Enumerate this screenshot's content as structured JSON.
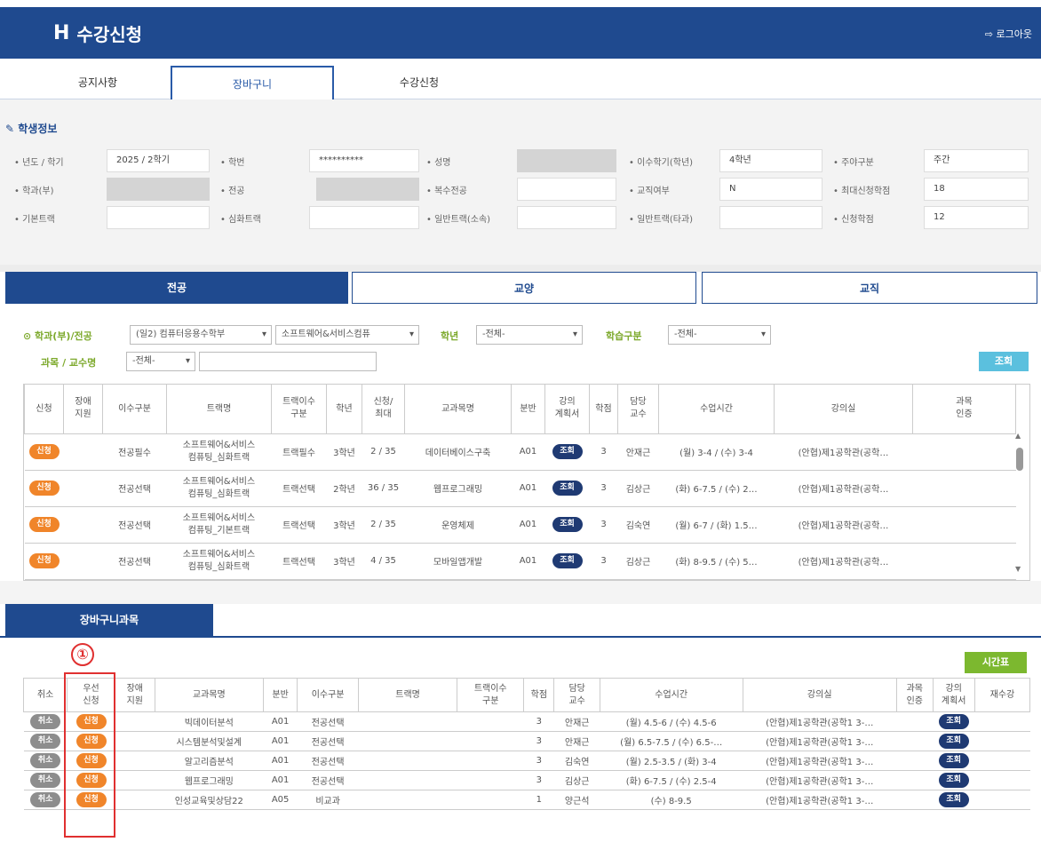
{
  "header": {
    "logo": "H",
    "title": "수강신청",
    "logout_label": "로그아웃"
  },
  "nav_tabs": [
    {
      "label": "공지사항",
      "active": false
    },
    {
      "label": "장바구니",
      "active": true
    },
    {
      "label": "수강신청",
      "active": false
    }
  ],
  "student_info": {
    "title": "학생정보",
    "fields": [
      {
        "label": "• 년도 / 학기",
        "value": "2025 / 2학기"
      },
      {
        "label": "• 학번",
        "value": "**********"
      },
      {
        "label": "• 성명",
        "value": ""
      },
      {
        "label": "• 이수학기(학년)",
        "value": "4학년"
      },
      {
        "label": "• 주야구분",
        "value": "주간"
      },
      {
        "label": "• 학과(부)",
        "value": ""
      },
      {
        "label": "• 전공",
        "value": ""
      },
      {
        "label": "• 복수전공",
        "value": ""
      },
      {
        "label": "• 교직여부",
        "value": "N"
      },
      {
        "label": "• 최대신청학점",
        "value": "18"
      },
      {
        "label": "• 기본트랙",
        "value": ""
      },
      {
        "label": "• 심화트랙",
        "value": ""
      },
      {
        "label": "• 일반트랙(소속)",
        "value": ""
      },
      {
        "label": "• 일반트랙(타과)",
        "value": ""
      },
      {
        "label": "• 신청학점",
        "value": "12"
      }
    ]
  },
  "category_tabs": [
    {
      "label": "전공",
      "active": true
    },
    {
      "label": "교양",
      "active": false
    },
    {
      "label": "교직",
      "active": false
    }
  ],
  "filters": {
    "dept_label": "학과(부)/전공",
    "dept_value": "(일2) 컴퓨터응용수학부",
    "major_value": "소프트웨어&서비스컴퓨",
    "year_label": "학년",
    "year_value": "-전체-",
    "type_label": "학습구분",
    "type_value": "-전체-",
    "subject_label": "과목 / 교수명",
    "subject_value": "-전체-",
    "search_text": "",
    "search_button": "조회"
  },
  "course_table": {
    "headers": [
      "신청",
      "장애\n지원",
      "이수구분",
      "트랙명",
      "트랙이수\n구분",
      "학년",
      "신청/\n최대",
      "교과목명",
      "분반",
      "강의\n계획서",
      "학점",
      "담당\n교수",
      "수업시간",
      "강의실",
      "과목\n인증"
    ],
    "apply_label": "신청",
    "syllabus_label": "조회",
    "rows": [
      {
        "type": "전공필수",
        "track": "소프트웨어&서비스\n컴퓨팅_심화트랙",
        "track_type": "트랙필수",
        "year": "3학년",
        "count": "2 / 35",
        "name": "데이터베이스구축",
        "section": "A01",
        "credit": "3",
        "prof": "안재근",
        "time": "(월) 3-4 / (수) 3-4",
        "room": "(안협)제1공학관(공학…"
      },
      {
        "type": "전공선택",
        "track": "소프트웨어&서비스\n컴퓨팅_심화트랙",
        "track_type": "트랙선택",
        "year": "2학년",
        "count": "36 / 35",
        "name": "웹프로그래밍",
        "section": "A01",
        "credit": "3",
        "prof": "김상근",
        "time": "(화) 6-7.5 / (수) 2…",
        "room": "(안협)제1공학관(공학…"
      },
      {
        "type": "전공선택",
        "track": "소프트웨어&서비스\n컴퓨팅_기본트랙",
        "track_type": "트랙선택",
        "year": "3학년",
        "count": "2 / 35",
        "name": "운영체제",
        "section": "A01",
        "credit": "3",
        "prof": "김숙연",
        "time": "(월) 6-7 / (화) 1.5…",
        "room": "(안협)제1공학관(공학…"
      },
      {
        "type": "전공선택",
        "track": "소프트웨어&서비스\n컴퓨팅_심화트랙",
        "track_type": "트랙선택",
        "year": "3학년",
        "count": "4 / 35",
        "name": "모바일앱개발",
        "section": "A01",
        "credit": "3",
        "prof": "김상근",
        "time": "(화) 8-9.5 / (수) 5…",
        "room": "(안협)제1공학관(공학…"
      }
    ]
  },
  "cart": {
    "title": "장바구니과목",
    "marker": "①",
    "timetable_button": "시간표",
    "headers": [
      "취소",
      "우선\n신청",
      "장애\n지원",
      "교과목명",
      "분반",
      "이수구분",
      "트랙명",
      "트랙이수\n구분",
      "학점",
      "담당\n교수",
      "수업시간",
      "강의실",
      "과목\n인증",
      "강의\n계획서",
      "재수강"
    ],
    "cancel_label": "취소",
    "priority_label": "신청",
    "syllabus_label": "조회",
    "rows": [
      {
        "name": "빅데이터분석",
        "section": "A01",
        "type": "전공선택",
        "credit": "3",
        "prof": "안재근",
        "time": "(월) 4.5-6 / (수) 4.5-6",
        "room": "(안협)제1공학관(공학1 3-…"
      },
      {
        "name": "시스템분석및설계",
        "section": "A01",
        "type": "전공선택",
        "credit": "3",
        "prof": "안재근",
        "time": "(월) 6.5-7.5 / (수) 6.5-…",
        "room": "(안협)제1공학관(공학1 3-…"
      },
      {
        "name": "알고리즘분석",
        "section": "A01",
        "type": "전공선택",
        "credit": "3",
        "prof": "김숙연",
        "time": "(월) 2.5-3.5 / (화) 3-4",
        "room": "(안협)제1공학관(공학1 3-…"
      },
      {
        "name": "웹프로그래밍",
        "section": "A01",
        "type": "전공선택",
        "credit": "3",
        "prof": "김상근",
        "time": "(화) 6-7.5 / (수) 2.5-4",
        "room": "(안협)제1공학관(공학1 3-…"
      },
      {
        "name": "인성교육및상담22",
        "section": "A05",
        "type": "비교과",
        "credit": "1",
        "prof": "양근석",
        "time": "(수) 8-9.5",
        "room": "(안협)제1공학관(공학1 3-…"
      }
    ]
  },
  "colors": {
    "primary": "#1f4a8f",
    "apply_orange": "#f0852a",
    "syllabus_navy": "#1f3a73",
    "cancel_gray": "#8d8d8d",
    "search_blue": "#5bc0de",
    "timetable_green": "#7cb82f",
    "highlight_red": "#e03030"
  }
}
